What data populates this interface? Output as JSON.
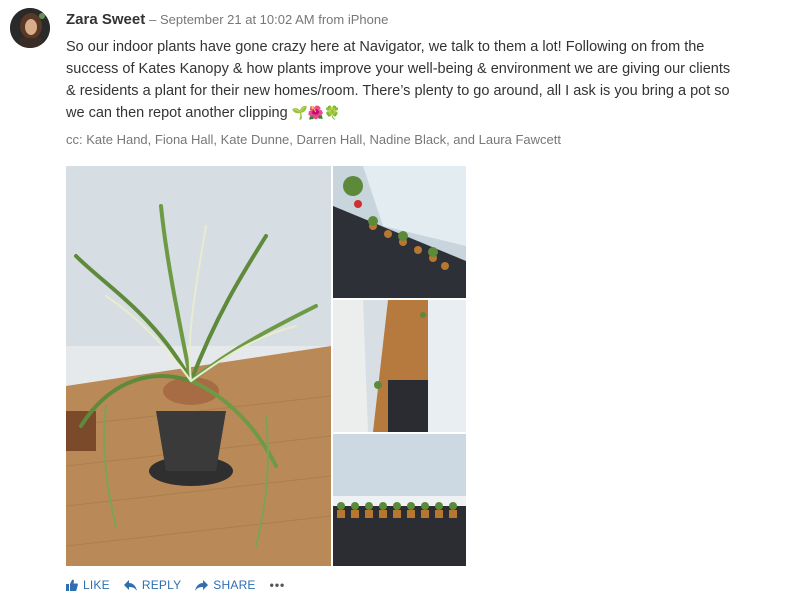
{
  "post": {
    "author": "Zara Sweet",
    "meta": "– September 21 at 10:02 AM from iPhone",
    "body": "So our indoor plants have gone crazy here at Navigator, we talk to them a lot! Following on from the success of Kates Kanopy & how plants improve your well-being & environment we are giving our clients & residents a plant for their new homes/room. There’s plenty to go around, all I ask is you bring a pot so we can then repot another clipping",
    "emojis": "🌱🌺🍀",
    "cc": "cc: Kate Hand, Fiona Hall, Kate Dunne, Darren Hall, Nadine Black, and Laura Fawcett"
  },
  "actions": {
    "like": "LIKE",
    "reply": "REPLY",
    "share": "SHARE",
    "more": "•••"
  },
  "colors": {
    "link": "#2f6fb0",
    "meta": "#777777",
    "text": "#333333"
  }
}
